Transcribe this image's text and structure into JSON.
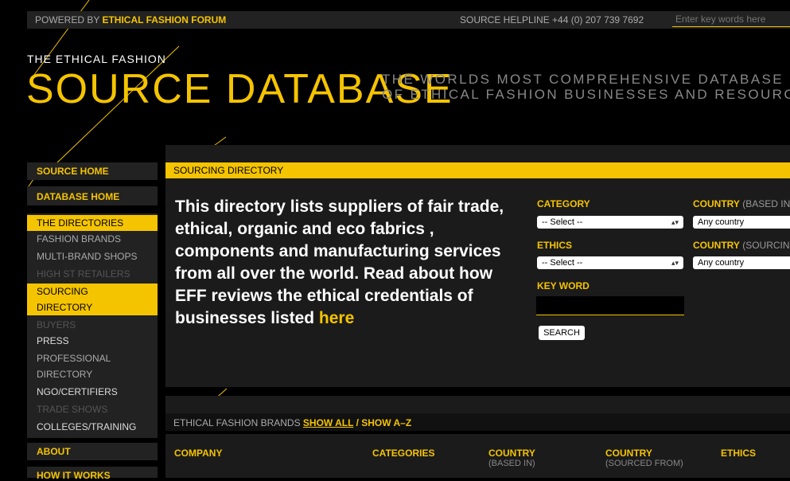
{
  "topbar": {
    "powered_prefix": "POWERED BY ",
    "powered_link": "ETHICAL FASHION FORUM",
    "helpline": "SOURCE HELPLINE +44 (0) 207 739 7692",
    "search_placeholder": "Enter key words here"
  },
  "logo": {
    "small": "THE ETHICAL FASHION",
    "big": "SOURCE DATABASE",
    "tagline_1": "THE WORLDS MOST COMPREHENSIVE DATABASE",
    "tagline_2": "OF ETHICAL FASHION BUSINESSES AND RESOURCES"
  },
  "sidebar": {
    "source_home": "SOURCE HOME",
    "database_home": "DATABASE HOME",
    "items": [
      "THE DIRECTORIES",
      "FASHION BRANDS",
      "MULTI-BRAND SHOPS",
      "HIGH ST RETAILERS",
      "SOURCING",
      "DIRECTORY",
      "BUYERS",
      "PRESS",
      "PROFESSIONAL",
      "DIRECTORY",
      "NGO/CERTIFIERS",
      "TRADE SHOWS",
      "COLLEGES/TRAINING"
    ],
    "about": "ABOUT",
    "how_it_works": "HOW IT WORKS"
  },
  "main": {
    "section_title": "SOURCING DIRECTORY",
    "intro": "This directory lists suppliers of fair trade, ethical, organic and eco fabrics , components and manufacturing services from all over the world. Read about how EFF reviews the ethical credentials of businesses listed ",
    "intro_link": "here"
  },
  "filters": {
    "category_label": "CATEGORY",
    "category_value": "-- Select --",
    "ethics_label": "ETHICS",
    "ethics_value": "-- Select --",
    "keyword_label": "KEY WORD",
    "country_based_label": "COUNTRY",
    "country_based_sub": " (BASED IN)",
    "country_based_value": "Any country",
    "country_sourcing_label": "COUNTRY",
    "country_sourcing_sub": " (SOURCING)",
    "country_sourcing_value": "Any country",
    "search_button": "SEARCH"
  },
  "brands": {
    "title": "ETHICAL FASHION BRANDS ",
    "show_all": "SHOW ALL",
    "separator": " / ",
    "show_az": "SHOW A–Z"
  },
  "table": {
    "col_company": "COMPANY",
    "col_categories": "CATEGORIES",
    "col_country_based": "COUNTRY",
    "col_country_based_sub": "(BASED IN)",
    "col_country_sourced": "COUNTRY",
    "col_country_sourced_sub": "(SOURCED FROM)",
    "col_ethics": "ETHICS"
  },
  "colors": {
    "accent": "#f5c400",
    "background": "#000000",
    "panel": "#1b1b1b"
  }
}
